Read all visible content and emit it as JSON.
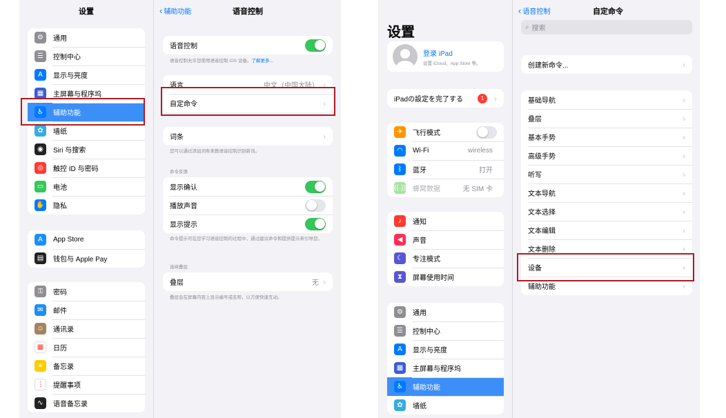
{
  "colors": {
    "accent": "#007aff",
    "green": "#34c759",
    "highlight": "#b2191e",
    "selected": "#3c8ff7"
  },
  "left": {
    "title": "设置",
    "group1": [
      {
        "label": "通用",
        "icon": "gear-icon",
        "color": "#8e8e93"
      },
      {
        "label": "控制中心",
        "icon": "switches-icon",
        "color": "#8e8e93"
      },
      {
        "label": "显示与亮度",
        "icon": "aa-icon",
        "color": "#007aff"
      },
      {
        "label": "主屏幕与程序坞",
        "icon": "grid-icon",
        "color": "#3a5bd9"
      },
      {
        "label": "辅助功能",
        "icon": "accessibility-icon",
        "color": "#007aff",
        "selected": true
      },
      {
        "label": "墙纸",
        "icon": "flower-icon",
        "color": "#32ade6"
      },
      {
        "label": "Siri 与搜索",
        "icon": "siri-icon",
        "color": "#222"
      },
      {
        "label": "触控 ID 与密码",
        "icon": "fingerprint-icon",
        "color": "#ff3b30"
      },
      {
        "label": "电池",
        "icon": "battery-icon",
        "color": "#34c759"
      },
      {
        "label": "隐私",
        "icon": "hand-icon",
        "color": "#007aff"
      }
    ],
    "group2": [
      {
        "label": "App Store",
        "icon": "appstore-icon",
        "color": "#1c8ef9"
      },
      {
        "label": "钱包与 Apple Pay",
        "icon": "wallet-icon",
        "color": "#222"
      }
    ],
    "group3": [
      {
        "label": "密码",
        "icon": "key-icon",
        "color": "#8e8e93"
      },
      {
        "label": "邮件",
        "icon": "mail-icon",
        "color": "#1c8ef9"
      },
      {
        "label": "通讯录",
        "icon": "contacts-icon",
        "color": "#a2845e"
      },
      {
        "label": "日历",
        "icon": "calendar-icon",
        "color": "#ffffff"
      },
      {
        "label": "备忘录",
        "icon": "notes-icon",
        "color": "#ffcc00"
      },
      {
        "label": "提醒事项",
        "icon": "reminders-icon",
        "color": "#ffffff"
      },
      {
        "label": "语音备忘录",
        "icon": "voicememo-icon",
        "color": "#222"
      }
    ]
  },
  "voice": {
    "back": "辅助功能",
    "title": "语音控制",
    "toggle_label": "语音控制",
    "toggle_note": "语音控制允许您使用语音控制 iOS 设备。",
    "learn_more": "了解更多...",
    "language_label": "语言",
    "language_value": "中文（中国大陆）",
    "custom_commands": "自定命令",
    "vocab_label": "词条",
    "vocab_note": "您可以通过添加词条来教语音控制识别新词。",
    "feedback_head": "命令反馈",
    "show_confirm": "显示确认",
    "play_sound": "播放声音",
    "show_hints": "显示提示",
    "hints_note": "命令提示可在您学习语音控制的过程中，通过建议命令和提供提示来引导您。",
    "overlay_head": "连续叠层",
    "overlay_label": "叠层",
    "overlay_value": "无",
    "overlay_note": "叠层会在屏幕内容上显示编号或名称，以方便快速互动。"
  },
  "right": {
    "title": "设置",
    "profile_name": "登录 iPad",
    "profile_sub": "设置 iCloud、App Store 等。",
    "setup_label": "iPadの設定を完了する",
    "setup_badge": "1",
    "net": [
      {
        "label": "飞行模式",
        "icon": "airplane-icon",
        "color": "#ff9500",
        "toggle": "off"
      },
      {
        "label": "Wi-Fi",
        "icon": "wifi-icon",
        "color": "#007aff",
        "value": "wireless"
      },
      {
        "label": "蓝牙",
        "icon": "bluetooth-icon",
        "color": "#007aff",
        "value": "打开"
      },
      {
        "label": "蜂窝数据",
        "icon": "cellular-icon",
        "color": "#a6e3a1",
        "value": "无 SIM 卡",
        "dim": true
      }
    ],
    "notif": [
      {
        "label": "通知",
        "icon": "bell-icon",
        "color": "#ff3b30"
      },
      {
        "label": "声音",
        "icon": "speaker-icon",
        "color": "#ff2d55"
      },
      {
        "label": "专注模式",
        "icon": "moon-icon",
        "color": "#5856d6"
      },
      {
        "label": "屏幕使用时间",
        "icon": "hourglass-icon",
        "color": "#5856d6"
      }
    ],
    "general": [
      {
        "label": "通用",
        "icon": "gear-icon",
        "color": "#8e8e93"
      },
      {
        "label": "控制中心",
        "icon": "switches-icon",
        "color": "#8e8e93"
      },
      {
        "label": "显示与亮度",
        "icon": "aa-icon",
        "color": "#007aff"
      },
      {
        "label": "主屏幕与程序坞",
        "icon": "grid-icon",
        "color": "#3a5bd9"
      },
      {
        "label": "辅助功能",
        "icon": "accessibility-icon",
        "color": "#007aff",
        "selected": true
      },
      {
        "label": "墙纸",
        "icon": "flower-icon",
        "color": "#32ade6"
      }
    ]
  },
  "custom": {
    "back": "语音控制",
    "title": "自定命令",
    "search_placeholder": "搜索",
    "create": "创建新命令...",
    "items": [
      "基础导航",
      "叠层",
      "基本手势",
      "高级手势",
      "听写",
      "文本导航",
      "文本选择",
      "文本编辑",
      "文本删除",
      "设备",
      "辅助功能"
    ]
  }
}
